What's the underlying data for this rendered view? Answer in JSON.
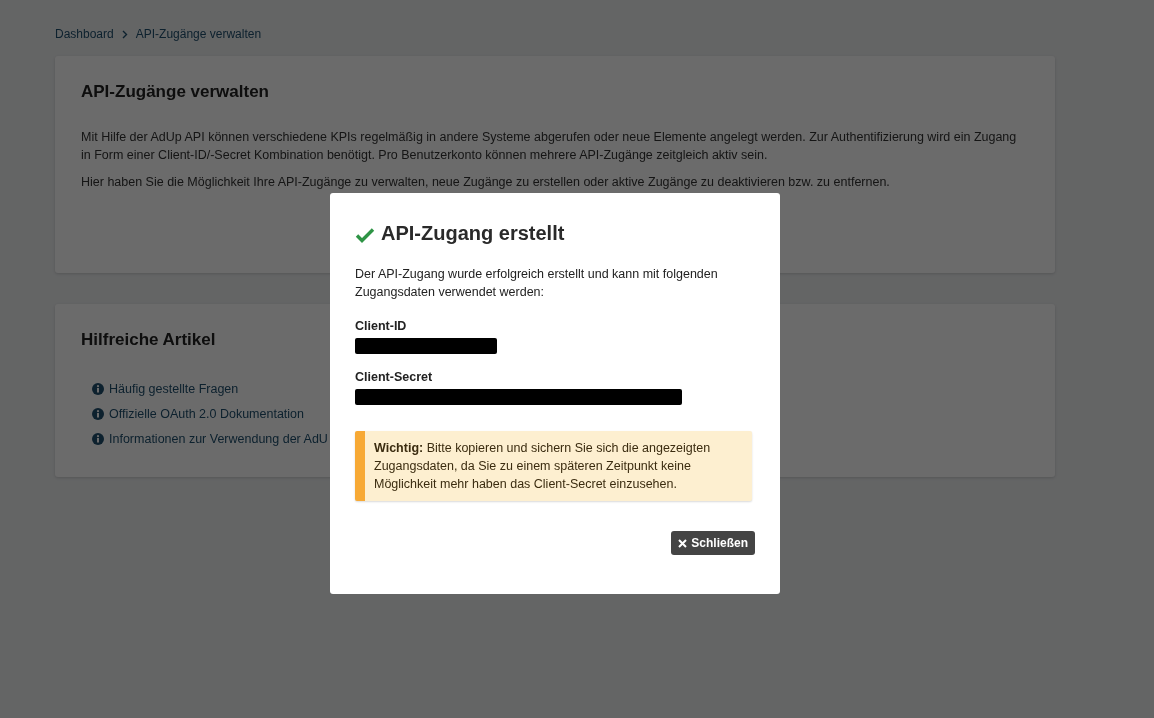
{
  "breadcrumb": [
    "Dashboard",
    "API-Zugänge verwalten"
  ],
  "intro_card": {
    "title": "API-Zugänge verwalten",
    "paragraphs": [
      "Mit Hilfe der AdUp API können verschiedene KPIs regelmäßig in andere Systeme abgerufen oder neue Elemente angelegt werden. Zur Authentifizierung wird ein Zugang in Form einer Client-ID/-Secret Kombination benötigt. Pro Benutzerkonto können mehrere API-Zugänge zeitgleich aktiv sein.",
      "Hier haben Sie die Möglichkeit Ihre API-Zugänge zu verwalten, neue Zugänge zu erstellen oder aktive Zugänge zu deaktivieren bzw. zu entfernen."
    ]
  },
  "articles_card": {
    "title": "Hilfreiche Artikel",
    "links": [
      "Häufig gestellte Fragen",
      "Offizielle OAuth 2.0 Dokumentation",
      "Informationen zur Verwendung der AdU"
    ]
  },
  "modal": {
    "title": "API-Zugang erstellt",
    "message": "Der API-Zugang wurde erfolgreich erstellt und kann mit folgenden Zugangsdaten verwendet werden:",
    "fields": [
      {
        "label": "Client-ID",
        "kind": "redacted"
      },
      {
        "label": "Client-Secret",
        "kind": "redacted"
      }
    ],
    "warning": "**Wichtig:** Bitte kopieren und sichern Sie sich die angezeigten Zugangsdaten, da Sie zu einem späteren Zeitpunkt keine Möglichkeit mehr haben das Client-Secret einzusehen.",
    "close_button": "Schließen"
  }
}
